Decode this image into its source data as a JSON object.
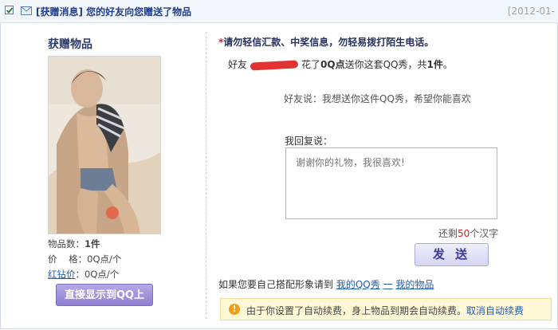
{
  "header": {
    "category": "[获赠消息]",
    "title": "您的好友向您赠送了物品",
    "date": "[2012-01-"
  },
  "gift": {
    "section_title": "获赠物品",
    "count_label": "物品数：",
    "count_value": "1件",
    "price_label": "价    格：",
    "price_value": "0Q点/个",
    "diamond_price_label": "红钻价",
    "diamond_price_value": "：0Q点/个",
    "show_button": "直接显示到QQ上"
  },
  "message": {
    "warning_star": "*",
    "warning": "请勿轻信汇款、中奖信息，勿轻易拨打陌生电话。",
    "friend_prefix": "好友",
    "friend_middle": "花了",
    "friend_amount": "0Q点",
    "friend_middle2": "送你这套QQ秀，共",
    "friend_count": "1件",
    "friend_end": "。",
    "friend_says": "好友说：我想送你这件QQ秀，希望你能喜欢",
    "reply_label": "我回复说：",
    "reply_placeholder": "谢谢你的礼物，我很喜欢!",
    "remaining_prefix": "还剩",
    "remaining_num": "50",
    "remaining_suffix": "个汉字",
    "send_button": "发 送",
    "dress_text": "如果您要自己搭配形象请到",
    "link_my_show": "我的QQ秀",
    "link_sep": "一",
    "link_my_items": "我的物品",
    "notice_text": "由于你设置了自动续费，身上物品到期会自动续费。",
    "notice_link": "取消自动续费"
  }
}
